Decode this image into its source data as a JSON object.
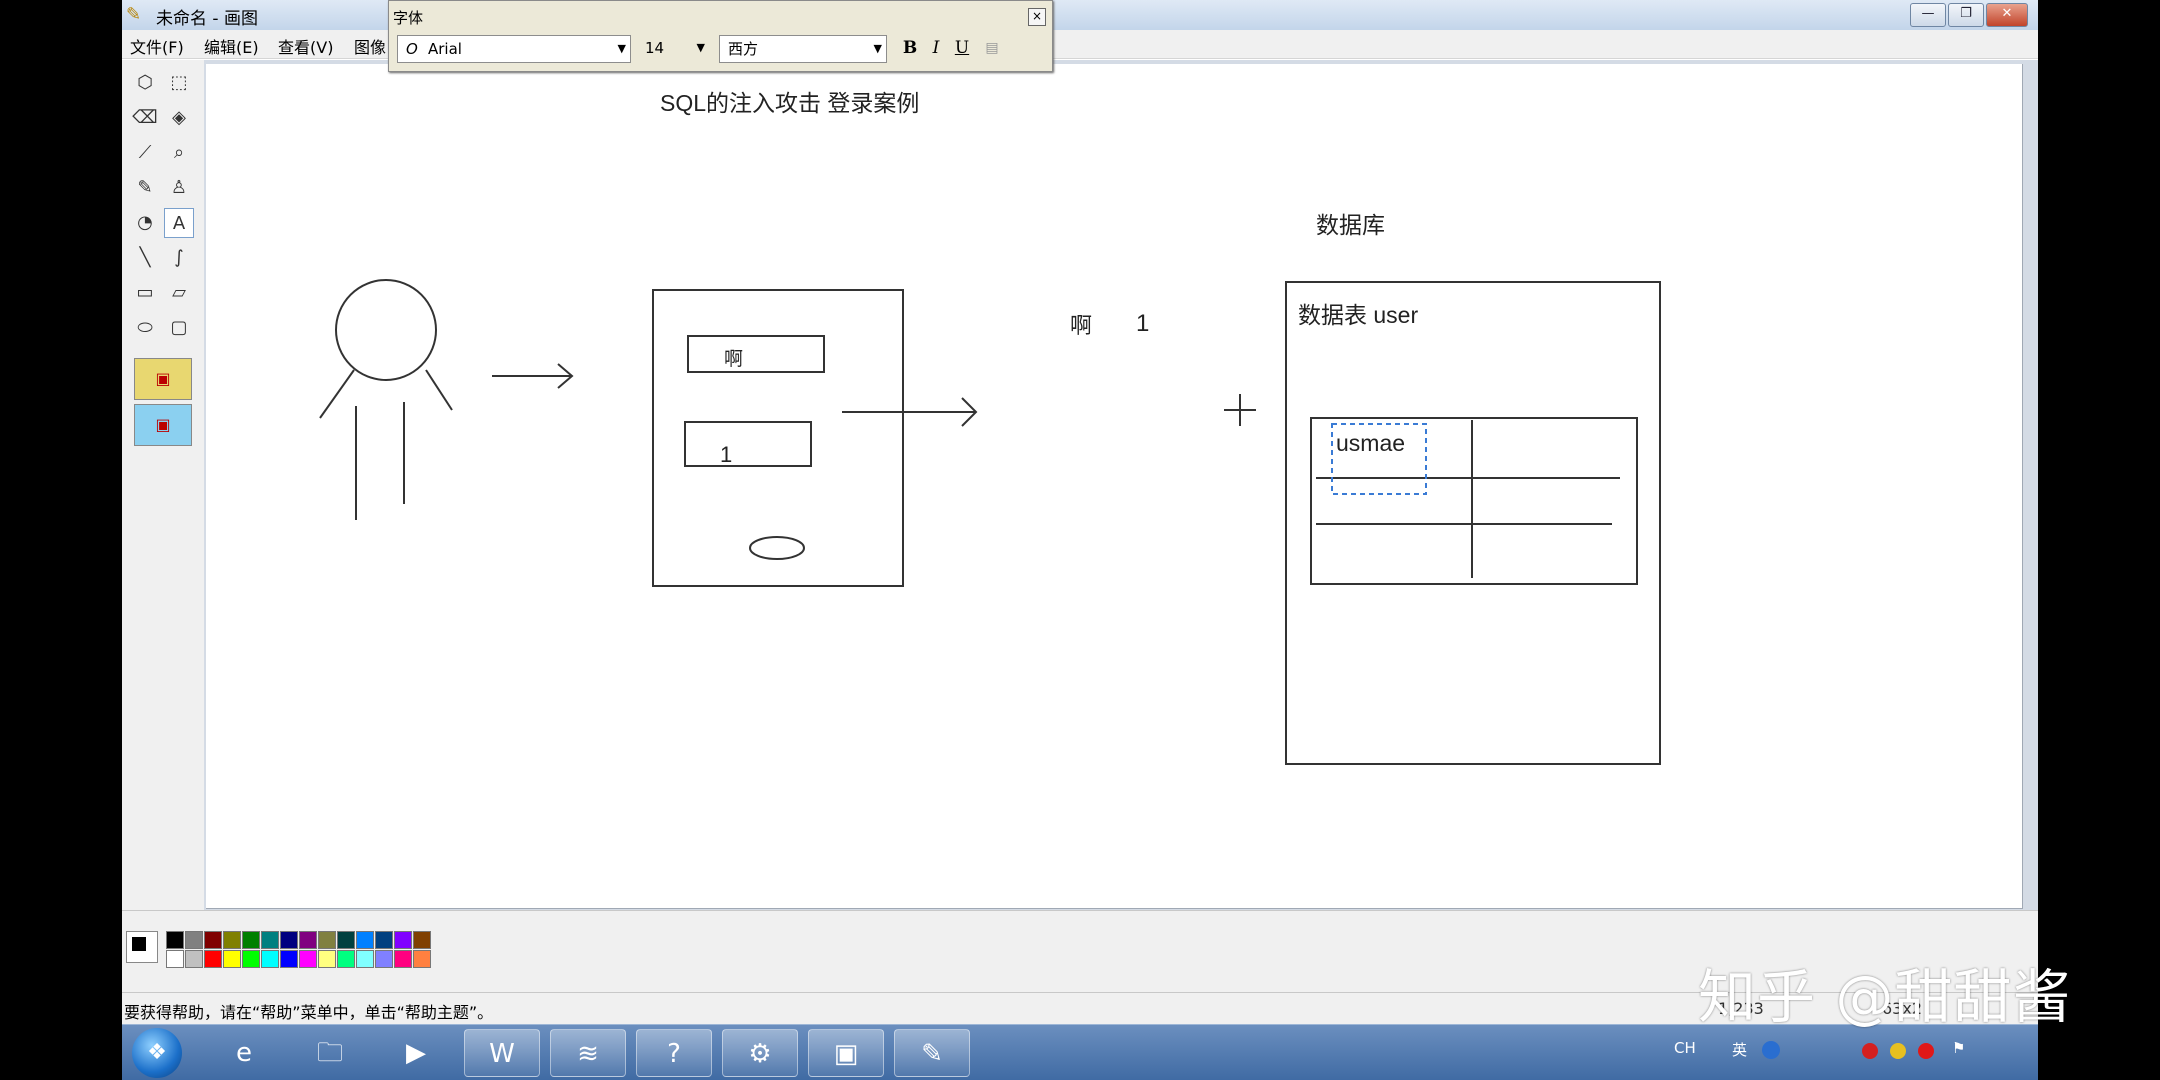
{
  "window": {
    "title": "未命名 - 画图",
    "buttons": {
      "minimize": "—",
      "restore": "❐",
      "close": "✕"
    }
  },
  "menubar": {
    "items": [
      "文件(F)",
      "编辑(E)",
      "查看(V)",
      "图像"
    ]
  },
  "font_toolbar": {
    "title": "字体",
    "font_name": "Arial",
    "font_glyph": "O",
    "font_size": "14",
    "script": "西方",
    "bold": "B",
    "italic": "I",
    "underline": "U",
    "close": "×"
  },
  "tools": [
    {
      "name": "free-select-icon",
      "glyph": "⬡"
    },
    {
      "name": "rect-select-icon",
      "glyph": "⬚"
    },
    {
      "name": "eraser-icon",
      "glyph": "⌫"
    },
    {
      "name": "fill-bucket-icon",
      "glyph": "◈"
    },
    {
      "name": "eyedropper-icon",
      "glyph": "⟋"
    },
    {
      "name": "magnifier-icon",
      "glyph": "⌕"
    },
    {
      "name": "pencil-icon",
      "glyph": "✎"
    },
    {
      "name": "brush-icon",
      "glyph": "♙"
    },
    {
      "name": "airbrush-icon",
      "glyph": "◔"
    },
    {
      "name": "text-icon",
      "glyph": "A"
    },
    {
      "name": "line-icon",
      "glyph": "╲"
    },
    {
      "name": "curve-icon",
      "glyph": "∫"
    },
    {
      "name": "rectangle-icon",
      "glyph": "▭"
    },
    {
      "name": "polygon-icon",
      "glyph": "⏥"
    },
    {
      "name": "ellipse-icon",
      "glyph": "⬭"
    },
    {
      "name": "rounded-rect-icon",
      "glyph": "▢"
    }
  ],
  "canvas": {
    "heading": "SQL的注入攻击   登录案例",
    "db_label": "数据库",
    "table_label": "数据表  user",
    "input1_text": "啊",
    "input2_text": "1",
    "sent_text1": "啊",
    "sent_text2": "1",
    "cell_text": "usmae"
  },
  "palette": {
    "top": [
      "#000000",
      "#808080",
      "#800000",
      "#808000",
      "#008000",
      "#008080",
      "#000080",
      "#800080",
      "#808040",
      "#004040",
      "#0080ff",
      "#004080",
      "#8000ff",
      "#804000"
    ],
    "bottom": [
      "#ffffff",
      "#c0c0c0",
      "#ff0000",
      "#ffff00",
      "#00ff00",
      "#00ffff",
      "#0000ff",
      "#ff00ff",
      "#ffff80",
      "#00ff80",
      "#80ffff",
      "#8080ff",
      "#ff0080",
      "#ff8040"
    ]
  },
  "statusbar": {
    "help_text": "要获得帮助，请在“帮助”菜单中，单击“帮助主题”。",
    "coords": "1,233",
    "size": "63x2"
  },
  "taskbar": {
    "start": "❖",
    "apps": [
      {
        "name": "ie-icon",
        "glyph": "e"
      },
      {
        "name": "explorer-icon",
        "glyph": "🗀"
      },
      {
        "name": "media-player-icon",
        "glyph": "▶"
      },
      {
        "name": "w-app-icon",
        "glyph": "W"
      },
      {
        "name": "dolphin-app-icon",
        "glyph": "≋"
      },
      {
        "name": "help-app-icon",
        "glyph": "?"
      },
      {
        "name": "settings-app-icon",
        "glyph": "⚙"
      },
      {
        "name": "remote-desktop-icon",
        "glyph": "▣"
      },
      {
        "name": "paint-app-icon",
        "glyph": "✎"
      }
    ],
    "tray": {
      "lang": "CH",
      "ime": "英"
    }
  },
  "watermark": "知乎 @甜甜酱"
}
